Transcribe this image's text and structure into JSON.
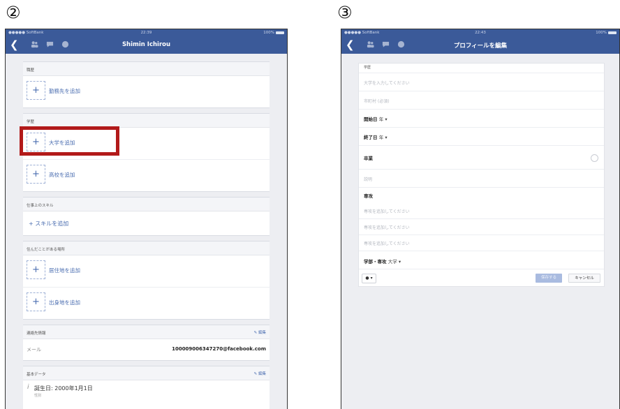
{
  "steps": {
    "left": "②",
    "right": "③"
  },
  "colors": {
    "facebook_blue": "#3b5a99",
    "link_blue": "#4a6db0",
    "highlight_red": "#b21a1a"
  },
  "left": {
    "status": {
      "carrier": "●●●●● SoftBank",
      "time": "22:39",
      "battery": "100%"
    },
    "nav": {
      "title": "Shimin Ichirou",
      "back_icon": "chevron-left-icon"
    },
    "work": {
      "header": "職歴",
      "add_label": "勤務先を追加"
    },
    "education": {
      "header": "学歴",
      "add_university": "大学を追加",
      "add_highschool": "高校を追加"
    },
    "skills": {
      "header": "仕事上のスキル",
      "add_label": "+ スキルを追加"
    },
    "places": {
      "header": "住んだことがある場所",
      "add_current": "居住地を追加",
      "add_hometown": "出身地を追加"
    },
    "contact": {
      "header": "連絡先情報",
      "edit": "編集",
      "email_label": "メール",
      "email_value": "100009006347270@facebook.com"
    },
    "basic": {
      "header": "基本データ",
      "edit": "編集",
      "birthday": "誕生日: 2000年1月1日",
      "gender": "性別"
    },
    "plus": "+"
  },
  "right": {
    "status": {
      "carrier": "●●●●● SoftBank",
      "time": "22:43",
      "battery": "100%"
    },
    "nav": {
      "title": "プロフィールを編集"
    },
    "section_header": "学歴",
    "university_placeholder": "大学を入力してください",
    "city_placeholder": "市町村 (必須)",
    "start_label": "開始日",
    "start_year": "年 ▾",
    "end_label": "終了日",
    "end_year": "年 ▾",
    "graduated_label": "卒業",
    "description_placeholder": "説明",
    "major_label": "専攻",
    "major_placeholders": [
      "専攻を追加してください",
      "専攻を追加してください",
      "専攻を追加してください"
    ],
    "degree_label": "学部・専攻",
    "degree_value": "大学 ▾",
    "privacy": "● ▾",
    "save": "保存する",
    "cancel": "キャンセル"
  }
}
